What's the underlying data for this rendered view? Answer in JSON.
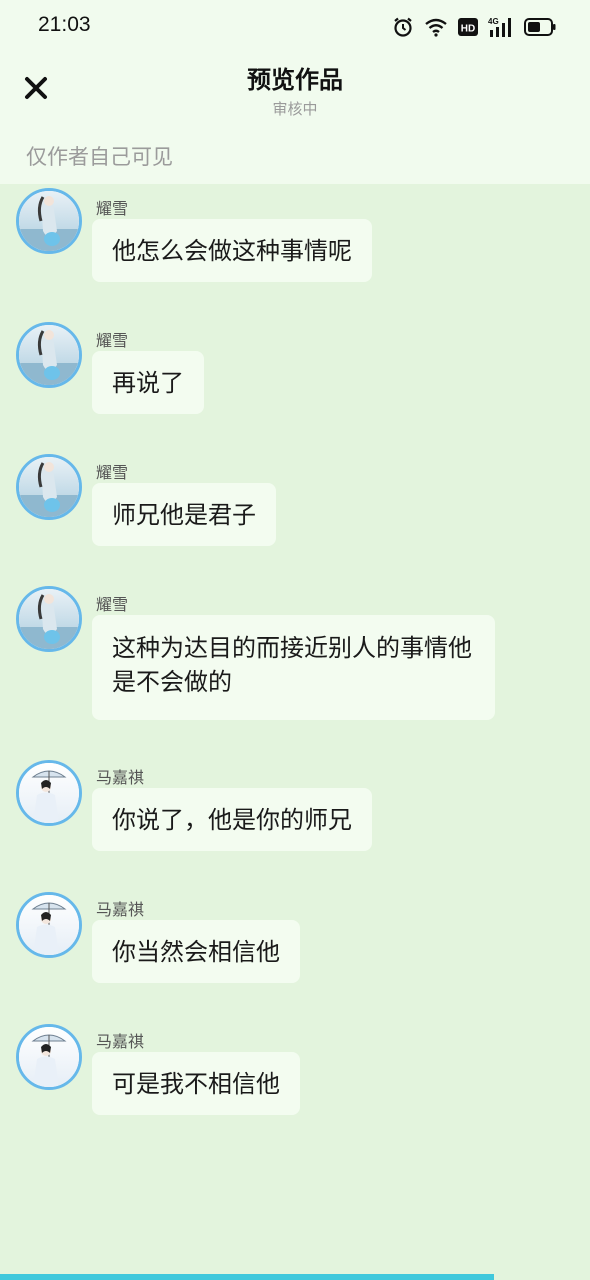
{
  "status": {
    "time": "21:03",
    "icons": [
      "alarm-icon",
      "wifi-icon",
      "hd-icon",
      "4g-signal-icon",
      "battery-icon"
    ],
    "hd_label": "HD",
    "network_label": "4G"
  },
  "header": {
    "title": "预览作品",
    "subtitle": "审核中",
    "close_icon": "close-icon",
    "visibility_note": "仅作者自己可见"
  },
  "messages": [
    {
      "sender": "耀雪",
      "text": "他怎么会做这种事情呢"
    },
    {
      "sender": "耀雪",
      "text": "再说了"
    },
    {
      "sender": "耀雪",
      "text": "师兄他是君子"
    },
    {
      "sender": "耀雪",
      "text": "这种为达目的而接近别人的事情他是不会做的"
    },
    {
      "sender": "马嘉祺",
      "text": "你说了，他是你的师兄"
    },
    {
      "sender": "马嘉祺",
      "text": "你当然会相信他"
    },
    {
      "sender": "马嘉祺",
      "text": "可是我不相信他"
    }
  ],
  "colors": {
    "background": "#e3f4dd",
    "header_background": "#f1fbee",
    "bubble": "#f3fcf0",
    "avatar_border": "#66b8ea",
    "bottom_progress": "#40c8dc"
  }
}
